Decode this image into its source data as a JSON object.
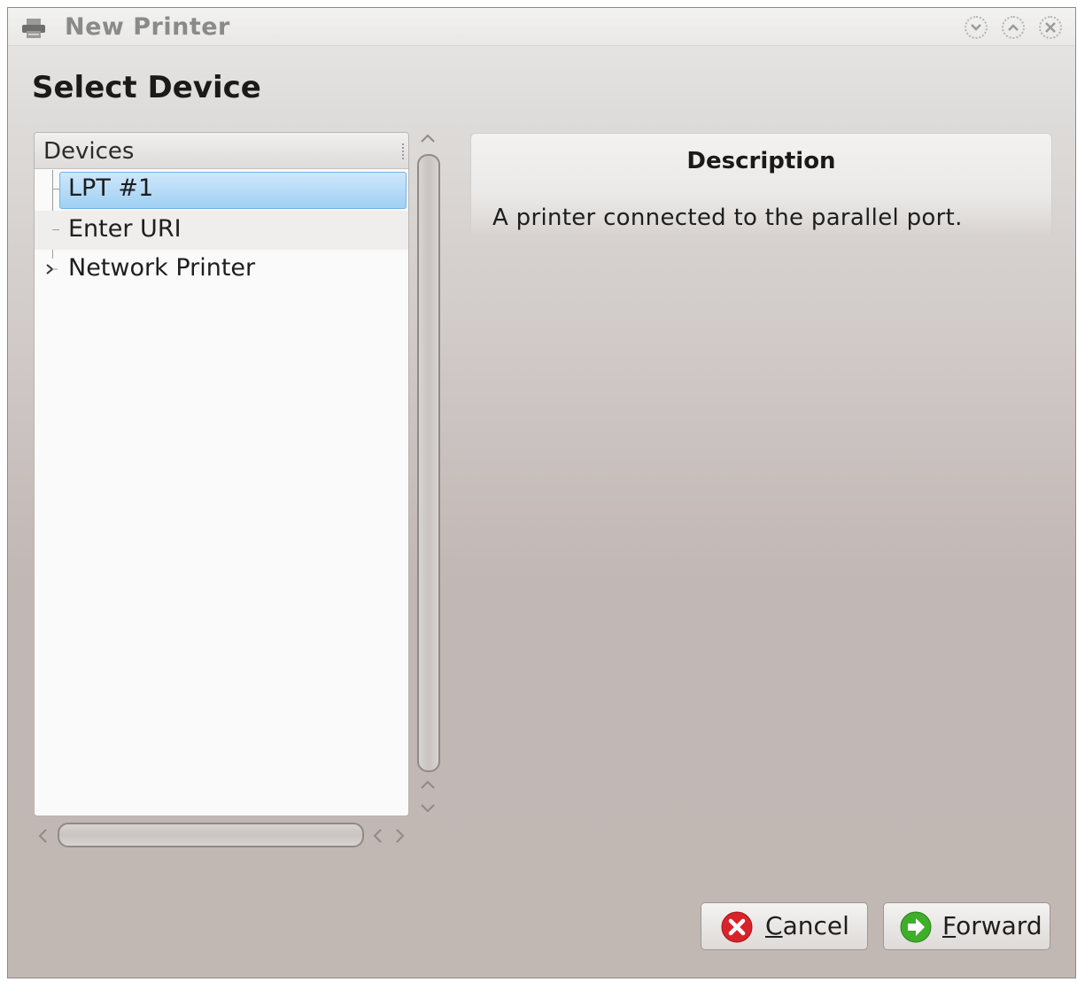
{
  "window": {
    "title": "New Printer",
    "icon": "printer-icon"
  },
  "page": {
    "heading": "Select Device"
  },
  "devices": {
    "header": "Devices",
    "items": [
      {
        "label": "LPT #1",
        "selected": true
      },
      {
        "label": "Enter URI",
        "selected": false
      },
      {
        "label": "Network Printer",
        "selected": false,
        "expandable": true
      }
    ]
  },
  "description": {
    "title": "Description",
    "text": "A printer connected to the parallel port."
  },
  "buttons": {
    "cancel_mnemonic": "C",
    "cancel_rest": "ancel",
    "forward_mnemonic": "F",
    "forward_rest": "orward"
  },
  "colors": {
    "selection": "#a9d4f5",
    "cancel_icon": "#d9232a",
    "forward_icon": "#3fae2a"
  }
}
